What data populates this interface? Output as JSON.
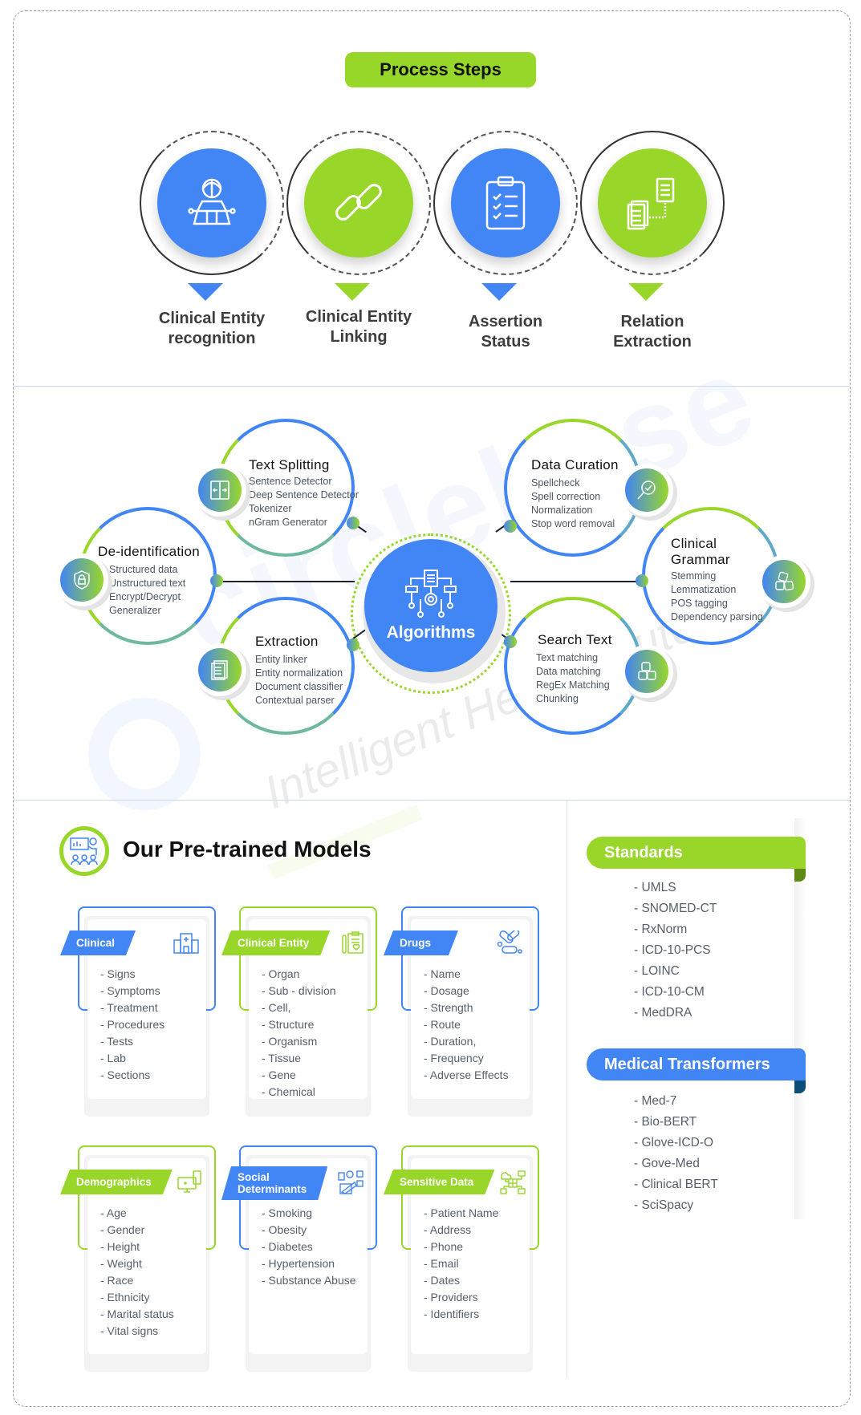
{
  "process": {
    "title": "Process Steps",
    "steps": [
      {
        "label_1": "Clinical Entity",
        "label_2": "recognition",
        "icon": "operator-icon",
        "color": "#4285f4"
      },
      {
        "label_1": "Clinical Entity",
        "label_2": "Linking",
        "icon": "link-icon",
        "color": "#98d72a"
      },
      {
        "label_1": "Assertion",
        "label_2": "Status",
        "icon": "clipboard-check-icon",
        "color": "#4285f4"
      },
      {
        "label_1": "Relation",
        "label_2": "Extraction",
        "icon": "documents-relation-icon",
        "color": "#98d72a"
      }
    ]
  },
  "algorithms": {
    "center_label": "Algorithms",
    "nodes": [
      {
        "title": "Text Splitting",
        "items": [
          "Sentence Detector",
          "Deep Sentence Detector",
          "Tokenizer",
          "nGram Generator"
        ],
        "icon": "split-icon"
      },
      {
        "title": "De-identification",
        "items": [
          "Structured data",
          "Unstructured text",
          "Encrypt/Decrypt",
          "Generalizer"
        ],
        "icon": "shield-lock-icon"
      },
      {
        "title": "Extraction",
        "items": [
          "Entity linker",
          "Entity normalization",
          "Document classifier",
          "Contextual parser"
        ],
        "icon": "document-list-icon"
      },
      {
        "title": "Data Curation",
        "items": [
          "Spellcheck",
          "Spell correction",
          "Normalization",
          "Stop word removal"
        ],
        "icon": "magnifier-check-icon"
      },
      {
        "title_1": "Clinical",
        "title_2": "Grammar",
        "items": [
          "Stemming",
          "Lemmatization",
          "POS tagging",
          "Dependency parsing"
        ],
        "icon": "blocks-icon"
      },
      {
        "title": "Search Text",
        "items": [
          "Text matching",
          "Data matching",
          "RegEx Matching",
          "Chunking"
        ],
        "icon": "blocks-search-icon"
      }
    ]
  },
  "watermark": {
    "brand": "circlebase",
    "tagline": "Intelligent Health Outcomes"
  },
  "models": {
    "title": "Our Pre-trained Models",
    "cards": [
      {
        "tag": "Clinical",
        "color": "#4285f4",
        "icon": "hospital-icon",
        "items": [
          "- Signs",
          "- Symptoms",
          "- Treatment",
          "- Procedures",
          "- Tests",
          "- Lab",
          "- Sections"
        ]
      },
      {
        "tag": "Clinical Entity",
        "color": "#98d72a",
        "icon": "clipboard-heart-icon",
        "items": [
          "- Organ",
          "- Sub - division",
          "- Cell,",
          "- Structure",
          "- Organism",
          "- Tissue",
          "- Gene",
          "- Chemical"
        ]
      },
      {
        "tag": "Drugs",
        "color": "#4285f4",
        "icon": "pills-icon",
        "items": [
          "- Name",
          "- Dosage",
          "- Strength",
          "- Route",
          "- Duration,",
          "- Frequency",
          "- Adverse Effects"
        ]
      },
      {
        "tag": "Demographics",
        "color": "#98d72a",
        "icon": "devices-icon",
        "items": [
          "- Age",
          "- Gender",
          "- Height",
          "- Weight",
          "- Race",
          "- Ethnicity",
          "- Marital status",
          "- Vital signs"
        ]
      },
      {
        "tag_1": "Social",
        "tag_2": "Determinants",
        "color": "#4285f4",
        "icon": "social-media-icon",
        "items": [
          "- Smoking",
          "- Obesity",
          "- Diabetes",
          "- Hypertension",
          "- Substance Abuse"
        ]
      },
      {
        "tag": "Sensitive Data",
        "color": "#98d72a",
        "icon": "data-network-icon",
        "items": [
          "- Patient Name",
          "- Address",
          "- Phone",
          "- Email",
          "- Dates",
          "- Providers",
          "- Identifiers"
        ]
      }
    ]
  },
  "standards": {
    "title": "Standards",
    "color": "#98d72a",
    "items": [
      "- UMLS",
      "- SNOMED-CT",
      "- RxNorm",
      "- ICD-10-PCS",
      "- LOINC",
      "- ICD-10-CM",
      "- MedDRA"
    ]
  },
  "transformers": {
    "title": "Medical Transformers",
    "color": "#4285f4",
    "items": [
      "- Med-7",
      "- Bio-BERT",
      "- Glove-ICD-O",
      "- Gove-Med",
      "- Clinical BERT",
      "- SciSpacy"
    ]
  }
}
